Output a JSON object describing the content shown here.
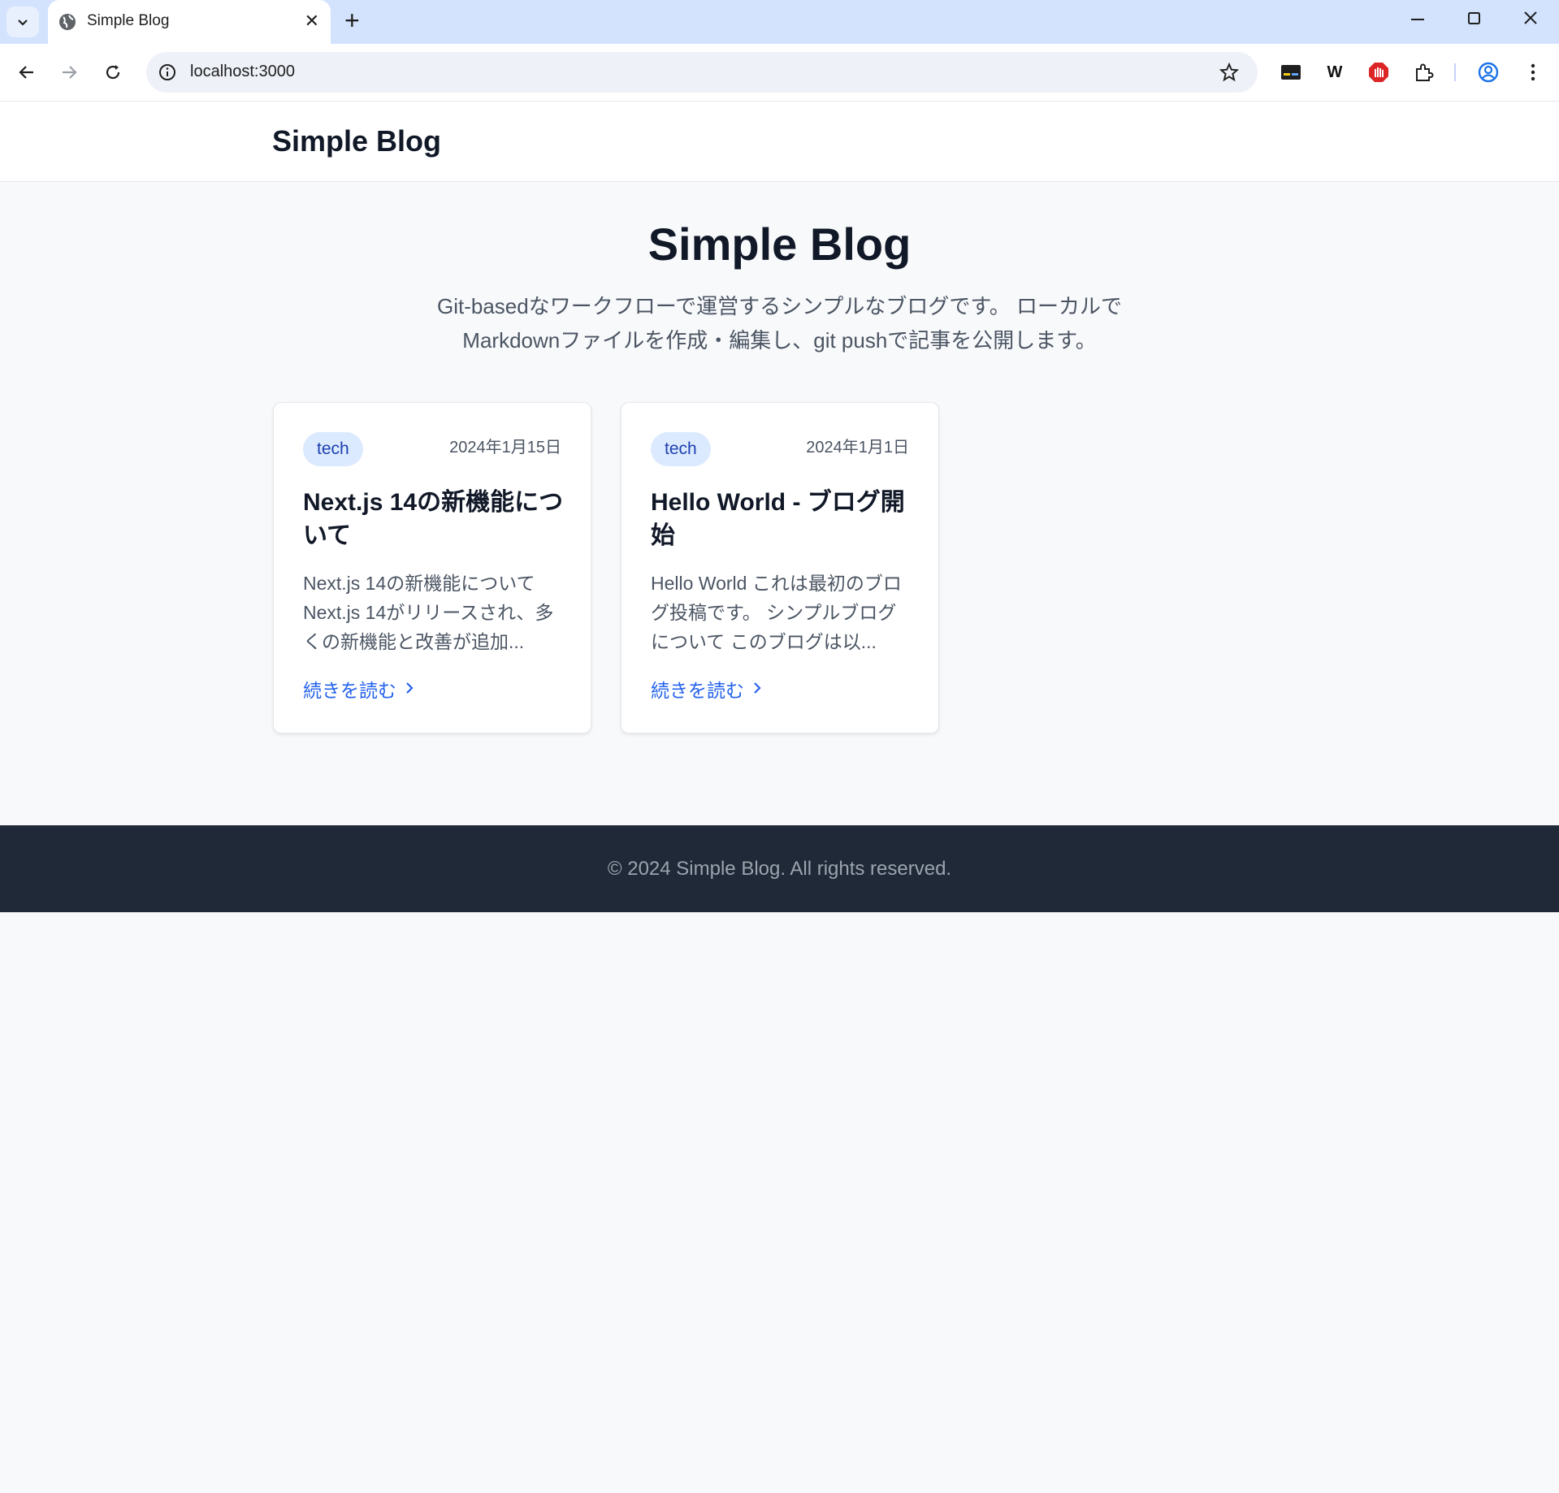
{
  "browser": {
    "tab_title": "Simple Blog",
    "url": "localhost:3000",
    "extension_w_label": "W"
  },
  "site": {
    "logo": "Simple Blog"
  },
  "hero": {
    "title": "Simple Blog",
    "description": "Git-basedなワークフローで運営するシンプルなブログです。 ローカルでMarkdownファイルを作成・編集し、git pushで記事を公開します。"
  },
  "posts": [
    {
      "tag": "tech",
      "date": "2024年1月15日",
      "title": "Next.js 14の新機能について",
      "excerpt": "Next.js 14の新機能について Next.js 14がリリースされ、多くの新機能と改善が追加...",
      "link": "続きを読む"
    },
    {
      "tag": "tech",
      "date": "2024年1月1日",
      "title": "Hello World - ブログ開始",
      "excerpt": "Hello World これは最初のブログ投稿です。 シンプルブログについて このブログは以...",
      "link": "続きを読む"
    }
  ],
  "footer": {
    "text": "© 2024 Simple Blog. All rights reserved."
  },
  "colors": {
    "accent": "#2563eb",
    "tag_bg": "#dbeafe",
    "footer_bg": "#1f2937",
    "tabbar_bg": "#d3e3fd"
  },
  "icons": [
    "tab-search-icon",
    "globe-icon",
    "close-icon",
    "plus-icon",
    "minimize-icon",
    "maximize-icon",
    "back-icon",
    "forward-icon",
    "reload-icon",
    "info-icon",
    "star-icon",
    "extension-icon",
    "profile-icon",
    "menu-icon",
    "chevron-right-icon"
  ]
}
